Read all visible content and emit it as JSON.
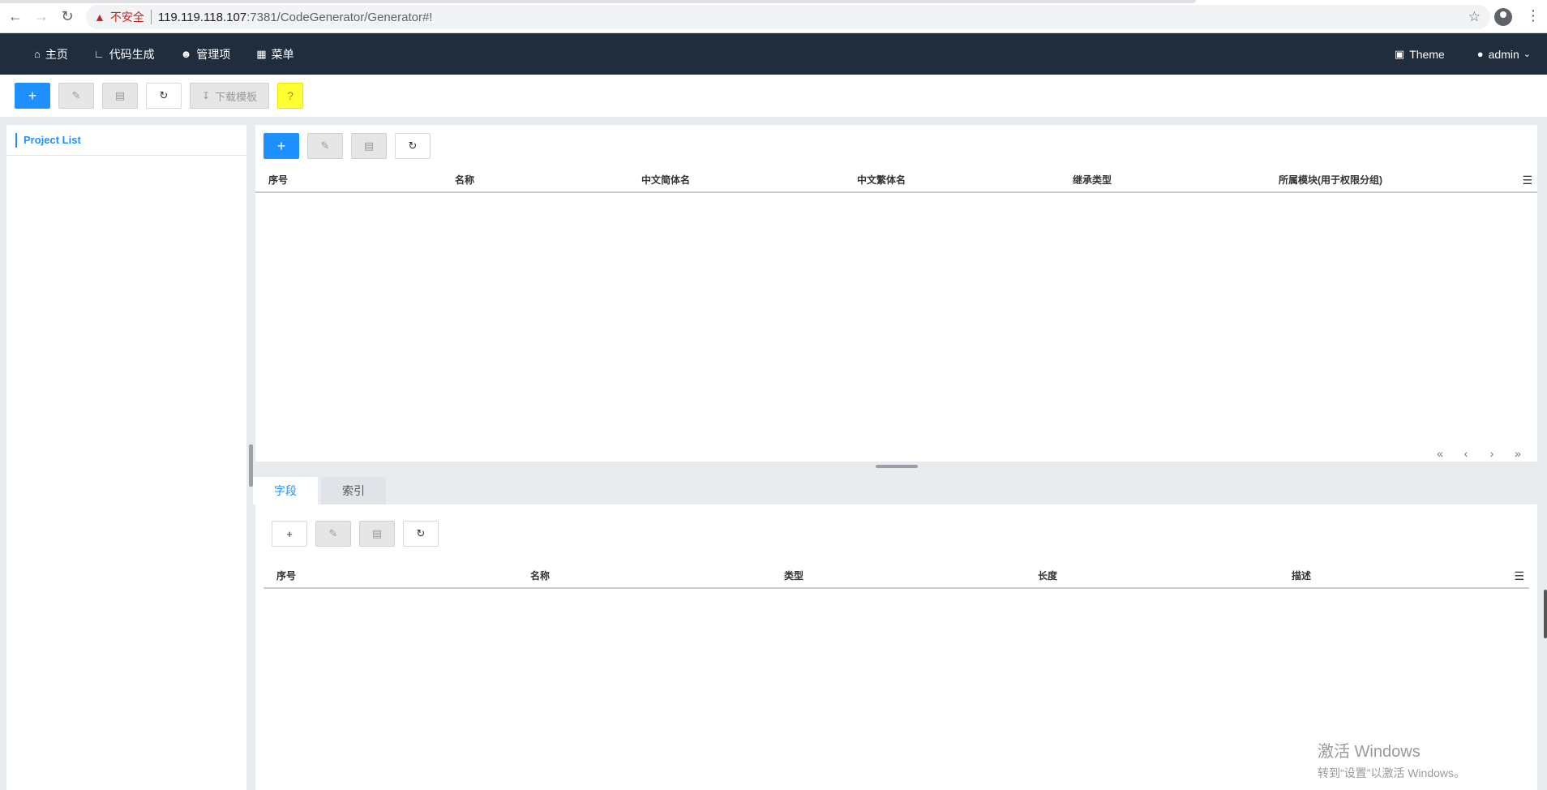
{
  "browser": {
    "insecure_label": "不安全",
    "url_host": "119.119.118.107",
    "url_path": ":7381/CodeGenerator/Generator#!"
  },
  "navbar": {
    "items": [
      {
        "label": "主页",
        "icon": "home-icon"
      },
      {
        "label": "代码生成",
        "icon": "chart-icon"
      },
      {
        "label": "管理项",
        "icon": "user-outline-icon"
      },
      {
        "label": "菜单",
        "icon": "grid-icon"
      }
    ],
    "theme_label": "Theme",
    "user_label": "admin"
  },
  "top_toolbar": {
    "download_template_label": "下载模板"
  },
  "sidebar": {
    "title": "Project List"
  },
  "upper_grid": {
    "columns": [
      "序号",
      "名称",
      "中文简体名",
      "中文繁体名",
      "继承类型",
      "所属模块(用于权限分组)"
    ],
    "pager": [
      "«",
      "‹",
      "›",
      "»"
    ]
  },
  "tabs": [
    {
      "label": "字段",
      "active": true
    },
    {
      "label": "索引",
      "active": false
    }
  ],
  "lower_grid": {
    "columns": [
      "序号",
      "名称",
      "类型",
      "长度",
      "描述"
    ]
  },
  "watermark": {
    "title": "激活 Windows",
    "subtitle": "转到“设置”以激活 Windows。"
  },
  "colors": {
    "navbar_bg": "#1f2d3d",
    "primary": "#1e90ff",
    "help_bg": "#ffff33"
  }
}
